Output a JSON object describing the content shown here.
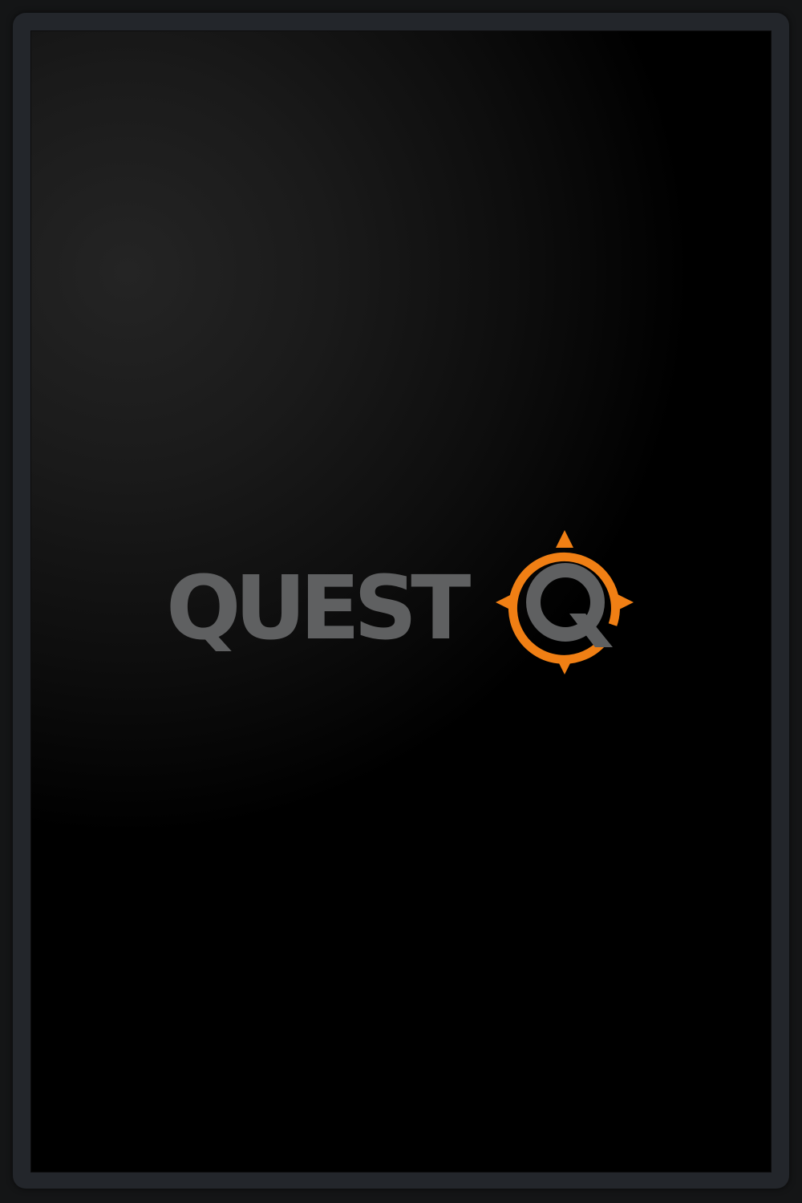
{
  "app": {
    "logo_text": "QUEST",
    "logo_icon": "compass-q-icon"
  },
  "colors": {
    "wordmark": "#5f6061",
    "accent": "#f07f14",
    "frame": "#23262b",
    "screen": "#000000"
  }
}
